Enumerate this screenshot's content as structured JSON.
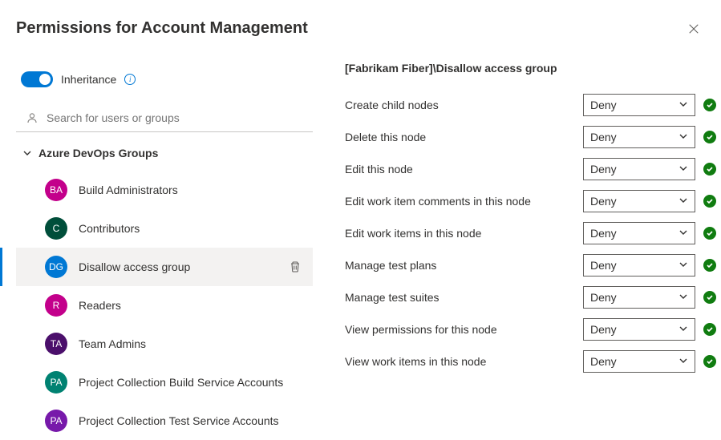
{
  "title": "Permissions for Account Management",
  "inheritance": {
    "label": "Inheritance",
    "on": true
  },
  "search": {
    "placeholder": "Search for users or groups"
  },
  "group_section": {
    "header": "Azure DevOps Groups",
    "expanded": true
  },
  "groups": [
    {
      "initials": "BA",
      "label": "Build Administrators",
      "color": "#c3008b",
      "selected": false
    },
    {
      "initials": "C",
      "label": "Contributors",
      "color": "#004e3a",
      "selected": false
    },
    {
      "initials": "DG",
      "label": "Disallow access group",
      "color": "#0078d4",
      "selected": true
    },
    {
      "initials": "R",
      "label": "Readers",
      "color": "#c3008b",
      "selected": false
    },
    {
      "initials": "TA",
      "label": "Team Admins",
      "color": "#4b0f6b",
      "selected": false
    },
    {
      "initials": "PA",
      "label": "Project Collection Build Service Accounts",
      "color": "#008272",
      "selected": false
    },
    {
      "initials": "PA",
      "label": "Project Collection Test Service Accounts",
      "color": "#7719aa",
      "selected": false
    }
  ],
  "scope_title": "[Fabrikam Fiber]\\Disallow access group",
  "permissions": [
    {
      "label": "Create child nodes",
      "value": "Deny"
    },
    {
      "label": "Delete this node",
      "value": "Deny"
    },
    {
      "label": "Edit this node",
      "value": "Deny"
    },
    {
      "label": "Edit work item comments in this node",
      "value": "Deny"
    },
    {
      "label": "Edit work items in this node",
      "value": "Deny"
    },
    {
      "label": "Manage test plans",
      "value": "Deny"
    },
    {
      "label": "Manage test suites",
      "value": "Deny"
    },
    {
      "label": "View permissions for this node",
      "value": "Deny"
    },
    {
      "label": "View work items in this node",
      "value": "Deny"
    }
  ]
}
